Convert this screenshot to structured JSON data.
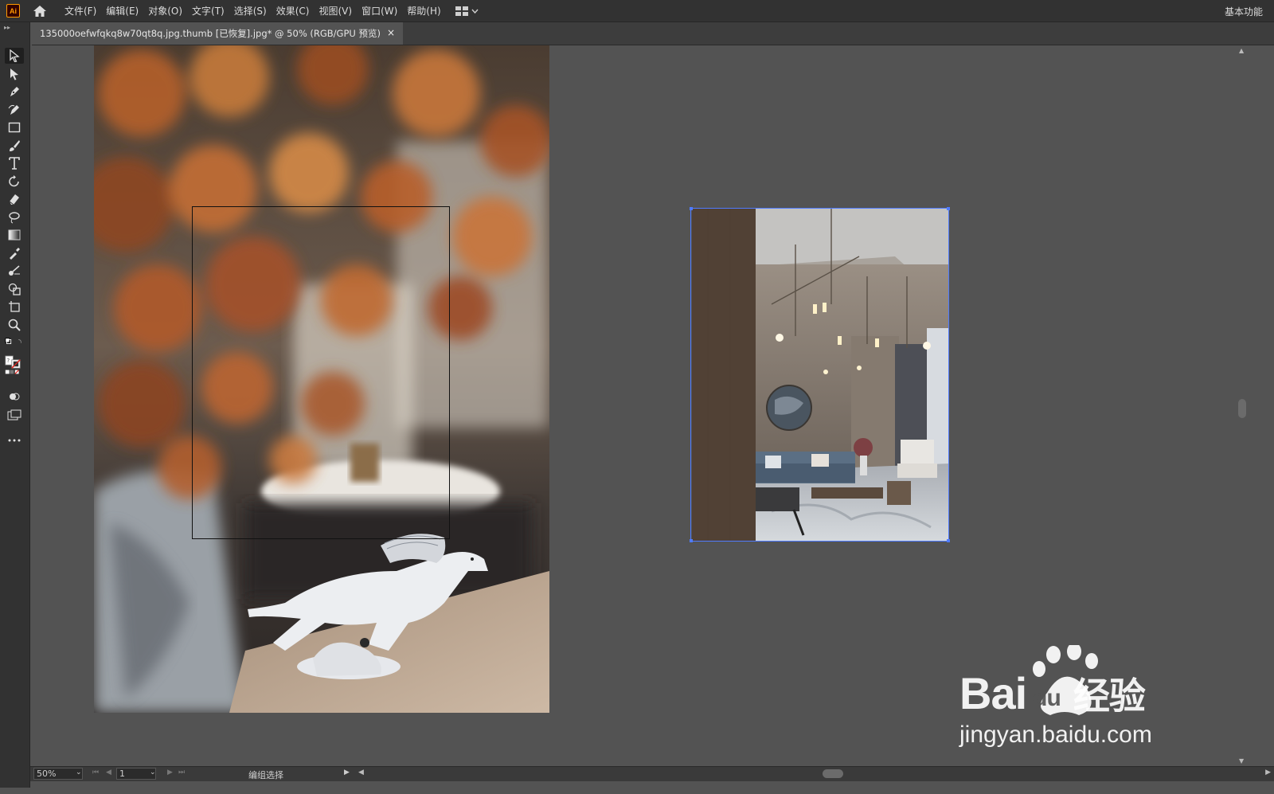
{
  "app": {
    "logo_text": "Ai",
    "workspace_label": "基本功能"
  },
  "menu": {
    "items": [
      "文件(F)",
      "编辑(E)",
      "对象(O)",
      "文字(T)",
      "选择(S)",
      "效果(C)",
      "视图(V)",
      "窗口(W)",
      "帮助(H)"
    ]
  },
  "document": {
    "tab_title": "135000oefwfqkq8w70qt8q.jpg.thumb [已恢复].jpg* @ 50% (RGB/GPU 预览)",
    "close_glyph": "×"
  },
  "status": {
    "zoom": "50%",
    "artboard_number": "1",
    "tool_status": "编组选择"
  },
  "watermark": {
    "brand": "Bai",
    "brand2": "du",
    "suffix": "经验",
    "url": "jingyan.baidu.com"
  },
  "colors": {
    "selection_blue": "#4f7bff",
    "app_orange": "#ff9a00"
  }
}
